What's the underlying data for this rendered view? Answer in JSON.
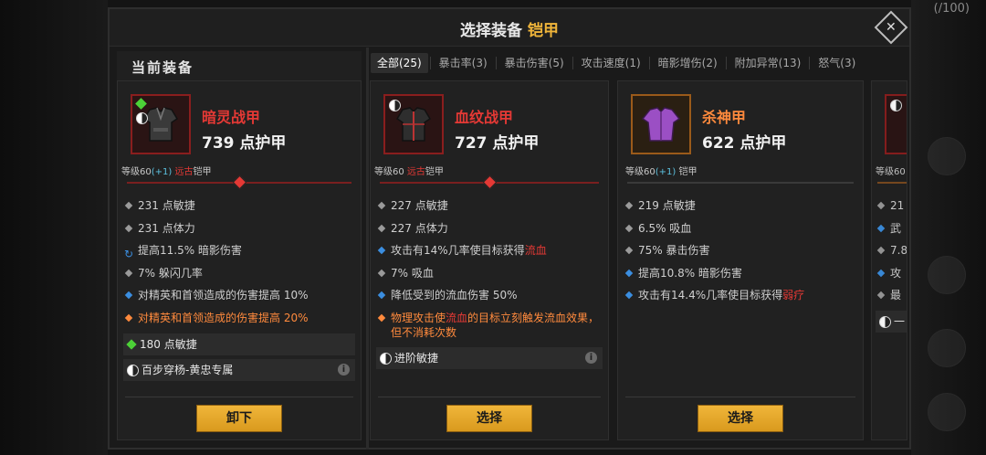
{
  "hud": {
    "top_right": "100"
  },
  "window": {
    "title": "选择装备",
    "title_accent": "铠甲"
  },
  "current": {
    "header": "当前装备"
  },
  "tabs": [
    "全部(25)",
    "暴击率(3)",
    "暴击伤害(5)",
    "攻击速度(1)",
    "暗影增伤(2)",
    "附加异常(13)",
    "怒气(3)"
  ],
  "cards": [
    {
      "name": "暗灵战甲",
      "armor": "739 点护甲",
      "level_prefix": "等级60",
      "level_plus": "(+1)",
      "level_tag": "远古",
      "level_suffix": "铠甲",
      "stats": [
        {
          "text": "231 点敏捷"
        },
        {
          "text": "231 点体力"
        },
        {
          "text": "提高11.5% 暗影伤害"
        },
        {
          "text": "7% 躲闪几率"
        },
        {
          "text": "对精英和首领造成的伤害提高 10%"
        },
        {
          "text": "对精英和首领造成的伤害提高 20%"
        }
      ],
      "gem": "180 点敏捷",
      "set": "百步穿杨-黄忠专属",
      "action": "卸下"
    },
    {
      "name": "血纹战甲",
      "armor": "727 点护甲",
      "level_prefix": "等级60",
      "level_tag": "远古",
      "level_suffix": "铠甲",
      "stats": [
        {
          "text": "227 点敏捷"
        },
        {
          "text": "227 点体力"
        },
        {
          "text": "攻击有14%几率使目标获得",
          "red": "流血"
        },
        {
          "text": "7% 吸血"
        },
        {
          "text": "降低受到的流血伤害 50%"
        },
        {
          "pre": "物理攻击使",
          "red": "流血",
          "post": "的目标立刻触发流血效果，但不消耗次数"
        }
      ],
      "set": "进阶敏捷",
      "action": "选择"
    },
    {
      "name": "杀神甲",
      "armor": "622 点护甲",
      "level_prefix": "等级60",
      "level_plus": "(+1)",
      "level_suffix": "铠甲",
      "stats": [
        {
          "text": "219 点敏捷"
        },
        {
          "text": "6.5% 吸血"
        },
        {
          "text": "75% 暴击伤害"
        },
        {
          "text": "提高10.8% 暗影伤害"
        },
        {
          "text": "攻击有14.4%几率使目标获得",
          "red": "弱疗"
        }
      ],
      "action": "选择"
    },
    {
      "level_prefix": "等级60",
      "stats": [
        {
          "text": "21"
        },
        {
          "text": "武"
        },
        {
          "text": "7.8"
        },
        {
          "text": "攻"
        },
        {
          "text": "最"
        }
      ],
      "set": "一"
    }
  ]
}
